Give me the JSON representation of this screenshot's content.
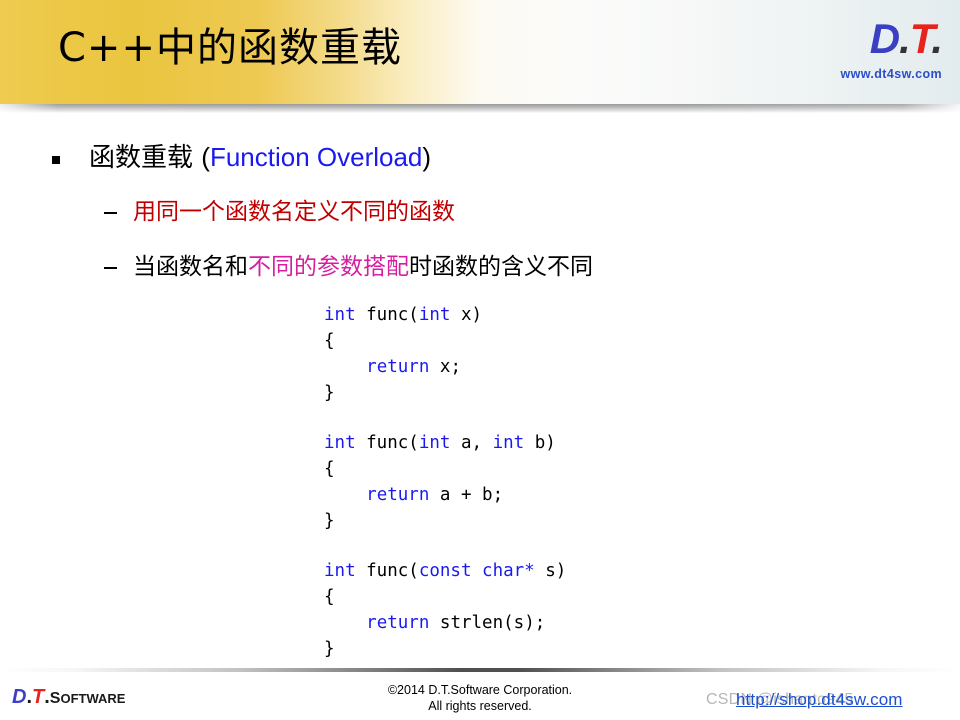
{
  "slide": {
    "title": "C++中的函数重载"
  },
  "header_logo": {
    "d": "D",
    "dot1": ".",
    "t": "T",
    "dot2": ".",
    "url": "www.dt4sw.com"
  },
  "content": {
    "bullet_level1": {
      "marker": "square-bullet",
      "text_cn": "函数重载 ",
      "paren_open": "(",
      "text_en": "Function Overload",
      "paren_close": ")"
    },
    "bullet_level2": [
      {
        "marker": "dash-bullet",
        "segments": [
          {
            "text": "用同一个函数名定义不同的函数",
            "color": "#c00000"
          }
        ]
      },
      {
        "marker": "dash-bullet",
        "segments": [
          {
            "text": "当函数名和",
            "color": "#000000"
          },
          {
            "text": "不同的参数搭配",
            "color": "#d31fa0"
          },
          {
            "text": "时函数的含义不同",
            "color": "#000000"
          }
        ]
      }
    ],
    "code": {
      "blocks": [
        {
          "lines": [
            [
              {
                "t": "int",
                "k": true
              },
              {
                "t": " func(",
                "k": false
              },
              {
                "t": "int",
                "k": true
              },
              {
                "t": " x)",
                "k": false
              }
            ],
            [
              {
                "t": "{",
                "k": false
              }
            ],
            [
              {
                "t": "    ",
                "k": false
              },
              {
                "t": "return",
                "k": true
              },
              {
                "t": " x;",
                "k": false
              }
            ],
            [
              {
                "t": "}",
                "k": false
              }
            ]
          ]
        },
        {
          "lines": [
            [
              {
                "t": "int",
                "k": true
              },
              {
                "t": " func(",
                "k": false
              },
              {
                "t": "int",
                "k": true
              },
              {
                "t": " a, ",
                "k": false
              },
              {
                "t": "int",
                "k": true
              },
              {
                "t": " b)",
                "k": false
              }
            ],
            [
              {
                "t": "{",
                "k": false
              }
            ],
            [
              {
                "t": "    ",
                "k": false
              },
              {
                "t": "return",
                "k": true
              },
              {
                "t": " a + b;",
                "k": false
              }
            ],
            [
              {
                "t": "}",
                "k": false
              }
            ]
          ]
        },
        {
          "lines": [
            [
              {
                "t": "int",
                "k": true
              },
              {
                "t": " func(",
                "k": false
              },
              {
                "t": "const char*",
                "k": true
              },
              {
                "t": " s)",
                "k": false
              }
            ],
            [
              {
                "t": "{",
                "k": false
              }
            ],
            [
              {
                "t": "    ",
                "k": false
              },
              {
                "t": "return",
                "k": true
              },
              {
                "t": " strlen(s);",
                "k": false
              }
            ],
            [
              {
                "t": "}",
                "k": false
              }
            ]
          ]
        }
      ]
    }
  },
  "footer": {
    "logo": {
      "d": "D",
      "dot1": ".",
      "t": "T",
      "dot2": ".",
      "software_cap": "S",
      "software_rest": "OFTWARE"
    },
    "copyright_line1": "©2014 D.T.Software Corporation.",
    "copyright_line2": "All rights reserved."
  },
  "watermarks": {
    "csdn": "CSDN @ishanto945",
    "link": "http://shop.dt4sw.com"
  },
  "colors": {
    "header_gold": "#eac53f",
    "keyword_blue": "#1a1af0",
    "accent_red": "#c00000",
    "accent_magenta": "#d31fa0",
    "logo_blue": "#3b3fc4",
    "logo_red": "#e8221d",
    "link_blue": "#1b4fd0"
  }
}
